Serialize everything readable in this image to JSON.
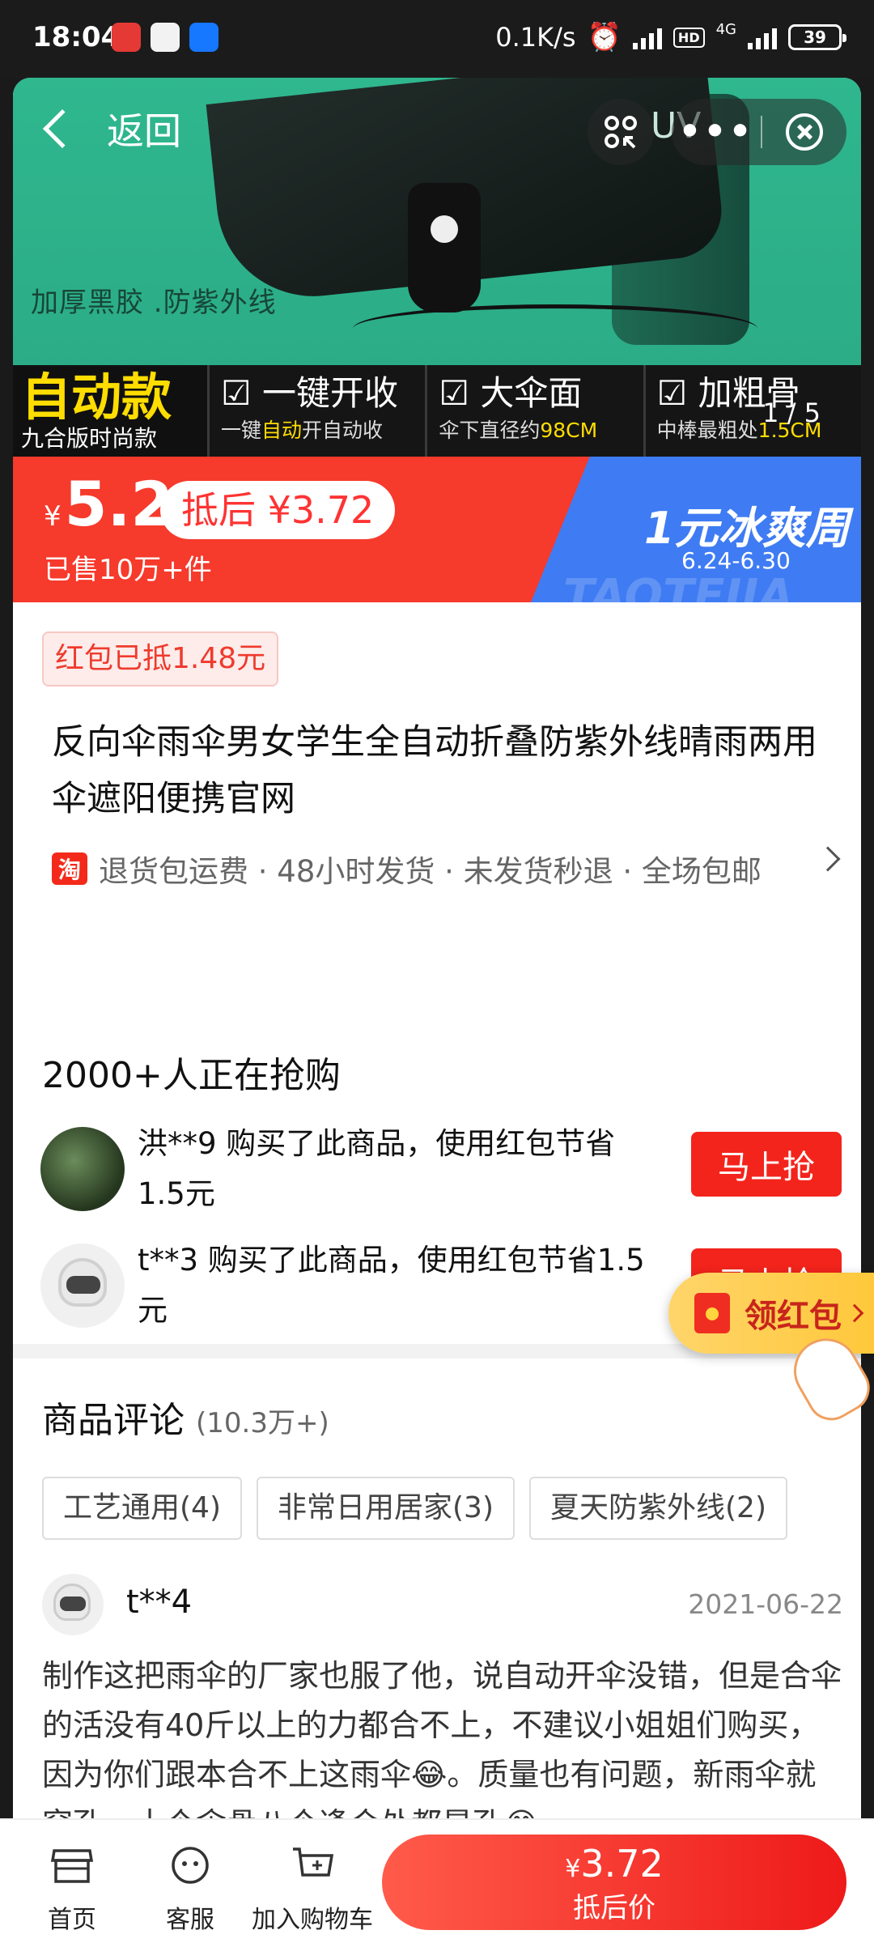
{
  "status": {
    "time": "18:04",
    "speed": "0.1K/s",
    "network": "4G",
    "hd": "HD",
    "battery": "39"
  },
  "nav": {
    "back_label": "返回"
  },
  "hero": {
    "uv_text": "UV",
    "caption": "加厚黑胶 .防紫外线",
    "main_feature": {
      "title": "自动款",
      "sub": "九合版时尚款"
    },
    "features": [
      {
        "title": "一键开收",
        "sub_pre": "一键",
        "sub_hl": "自动",
        "sub_post": "开自动收"
      },
      {
        "title": "大伞面",
        "sub_pre": "伞下直径约",
        "sub_hl": "98CM",
        "sub_post": ""
      },
      {
        "title": "加粗骨",
        "sub_pre": "中棒最粗处",
        "sub_hl": "1.5CM",
        "sub_post": ""
      }
    ],
    "pager": "1 / 5",
    "colors": {
      "bg": "#2fb78e"
    }
  },
  "price": {
    "currency": "¥",
    "value": "5.2",
    "after_discount": "抵后 ¥3.72",
    "sold": "已售10万+件",
    "promo_title": "1元冰爽周",
    "promo_date": "6.24-6.30",
    "promo_watermark": "TAOTEJIA",
    "colors": {
      "red": "#f63a2c",
      "blue": "#3f7cf3"
    }
  },
  "info": {
    "redpack_tag": "红包已抵1.48元",
    "title": "反向伞雨伞男女学生全自动折叠防紫外线晴雨两用伞遮阳便携官网",
    "tao_badge": "淘",
    "services": "退货包运费 · 48小时发货 · 未发货秒退 · 全场包邮"
  },
  "buying": {
    "title": "2000+人正在抢购",
    "buyers": [
      {
        "text": "洪**9 购买了此商品，使用红包节省1.5元",
        "button": "马上抢"
      },
      {
        "text": "t**3 购买了此商品，使用红包节省1.5元",
        "button": "马上抢"
      }
    ]
  },
  "reviews": {
    "title": "商品评论",
    "count": "(10.3万+)",
    "tags": [
      "工艺通用(4)",
      "非常日用居家(3)",
      "夏天防紫外线(2)"
    ],
    "first": {
      "user": "t**4",
      "date": "2021-06-22",
      "body": "制作这把雨伞的厂家也服了他，说自动开伞没错，但是合伞的活没有40斤以上的力都合不上，不建议小姐姐们购买，因为你们跟本合不上这雨伞😂。质量也有问题，新雨伞就穿孔，十个伞骨八个逢合处都是孔😂"
    }
  },
  "float": {
    "redpack_label": "领红包"
  },
  "bottom": {
    "home": "首页",
    "service": "客服",
    "cart": "加入购物车",
    "buy_currency": "¥",
    "buy_price": "3.72",
    "buy_label": "抵后价"
  }
}
